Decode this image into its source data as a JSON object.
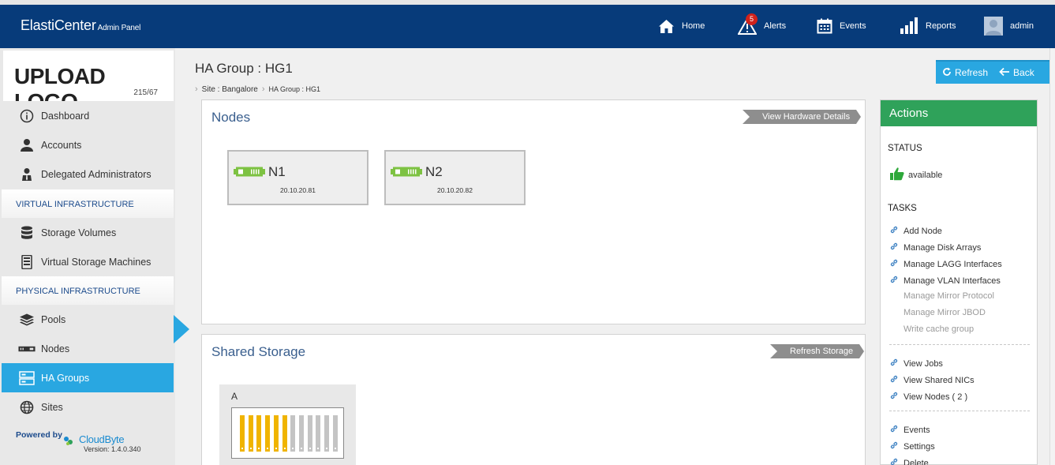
{
  "header": {
    "brand": "ElastiCenter",
    "brand_sub": "Admin Panel",
    "nav": [
      {
        "label": "Home",
        "icon": "home-icon"
      },
      {
        "label": "Alerts",
        "icon": "alert-icon",
        "badge": "5"
      },
      {
        "label": "Events",
        "icon": "calendar-icon"
      },
      {
        "label": "Reports",
        "icon": "bar-chart-icon"
      },
      {
        "label": "admin",
        "icon": "avatar"
      }
    ]
  },
  "sidebar": {
    "logo_text": "UPLOAD LOGO",
    "logo_dims": "215/67",
    "items": [
      {
        "label": "Dashboard",
        "icon": "info-icon"
      },
      {
        "label": "Accounts",
        "icon": "user-icon"
      },
      {
        "label": "Delegated Administrators",
        "icon": "admin-user-icon"
      }
    ],
    "section_virtual": "VIRTUAL INFRASTRUCTURE",
    "virtual_items": [
      {
        "label": "Storage Volumes",
        "icon": "database-icon"
      },
      {
        "label": "Virtual Storage Machines",
        "icon": "server-icon"
      }
    ],
    "section_physical": "PHYSICAL INFRASTRUCTURE",
    "physical_items": [
      {
        "label": "Pools",
        "icon": "layers-icon"
      },
      {
        "label": "Nodes",
        "icon": "node-icon"
      },
      {
        "label": "HA Groups",
        "icon": "ha-group-icon",
        "active": true
      },
      {
        "label": "Sites",
        "icon": "globe-icon"
      }
    ],
    "powered_by": "Powered by",
    "cloudbyte": "CloudByte",
    "version": "Version: 1.4.0.340"
  },
  "main": {
    "title": "HA Group : HG1",
    "breadcrumb": [
      "Site : Bangalore",
      "HA Group : HG1"
    ],
    "toolbar": {
      "refresh": "Refresh",
      "back": "Back"
    },
    "nodes_panel": {
      "title": "Nodes",
      "button": "View Hardware Details",
      "nodes": [
        {
          "name": "N1",
          "ip": "20.10.20.81"
        },
        {
          "name": "N2",
          "ip": "20.10.20.82"
        }
      ]
    },
    "storage_panel": {
      "title": "Shared Storage",
      "button": "Refresh Storage",
      "array_label": "A",
      "slots_used": 6,
      "slots_total": 12
    }
  },
  "actions": {
    "title": "Actions",
    "status_label": "STATUS",
    "status_value": "available",
    "tasks_label": "TASKS",
    "tasks": [
      {
        "label": "Add Node",
        "enabled": true
      },
      {
        "label": "Manage Disk Arrays",
        "enabled": true
      },
      {
        "label": "Manage LAGG Interfaces",
        "enabled": true
      },
      {
        "label": "Manage VLAN Interfaces",
        "enabled": true
      },
      {
        "label": "Manage Mirror Protocol",
        "enabled": false
      },
      {
        "label": "Manage Mirror JBOD",
        "enabled": false
      },
      {
        "label": "Write cache group",
        "enabled": false
      }
    ],
    "views": [
      {
        "label": "View Jobs"
      },
      {
        "label": "View Shared NICs"
      },
      {
        "label": "View Nodes ( 2 )"
      }
    ],
    "misc": [
      {
        "label": "Events"
      },
      {
        "label": "Settings"
      },
      {
        "label": "Delete"
      }
    ]
  },
  "colors": {
    "header_bg": "#073b7a",
    "accent_blue": "#29a7e1",
    "actions_green": "#2fa25a",
    "slot_used": "#f0b400",
    "slot_free": "#c4c4c4"
  }
}
